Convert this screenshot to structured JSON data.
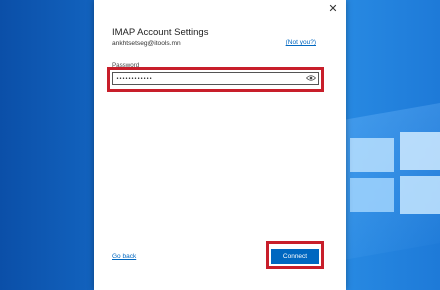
{
  "dialog": {
    "close_label": "✕",
    "title": "IMAP Account Settings",
    "email": "ankhtsetseg@itools.mn",
    "not_you_label": "(Not you?)",
    "password_label": "Password",
    "password_value": "••••••••••••",
    "go_back_label": "Go back",
    "connect_label": "Connect"
  },
  "colors": {
    "accent": "#0067c0",
    "highlight": "#c81e2a"
  },
  "icons": {
    "reveal": "eye-icon",
    "close": "close-icon"
  }
}
